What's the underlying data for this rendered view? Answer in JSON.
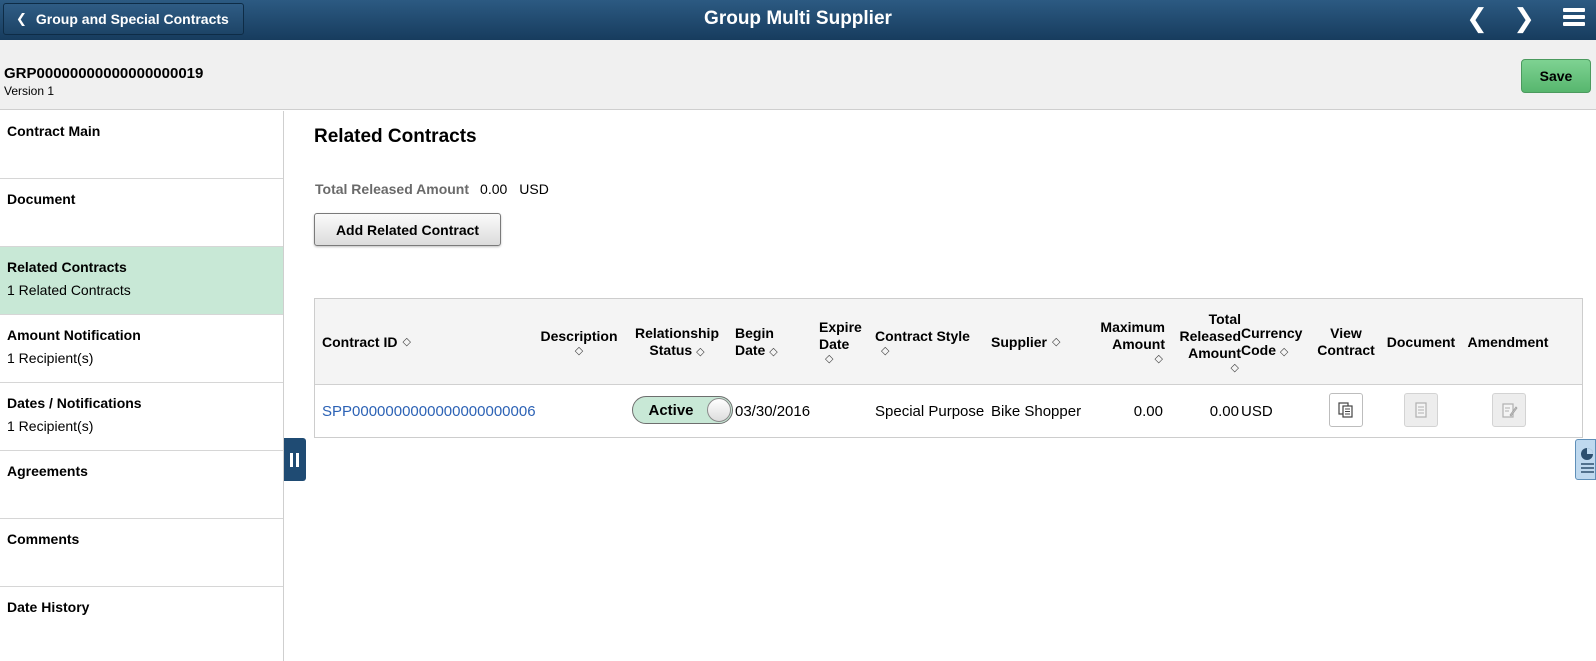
{
  "banner": {
    "back_label": "Group and Special Contracts",
    "title": "Group Multi Supplier"
  },
  "header": {
    "group_id": "GRP00000000000000000019",
    "version": "Version 1",
    "save_label": "Save"
  },
  "sidebar": {
    "items": [
      {
        "label": "Contract Main",
        "sub": ""
      },
      {
        "label": "Document",
        "sub": ""
      },
      {
        "label": "Related Contracts",
        "sub": "1 Related Contracts",
        "selected": true
      },
      {
        "label": "Amount Notification",
        "sub": "1 Recipient(s)"
      },
      {
        "label": "Dates / Notifications",
        "sub": "1 Recipient(s)"
      },
      {
        "label": "Agreements",
        "sub": ""
      },
      {
        "label": "Comments",
        "sub": ""
      },
      {
        "label": "Date History",
        "sub": ""
      }
    ]
  },
  "main": {
    "title": "Related Contracts",
    "total_label": "Total Released Amount",
    "total_value": "0.00",
    "total_currency": "USD",
    "add_label": "Add Related Contract"
  },
  "grid": {
    "columns": {
      "contract_id": "Contract ID",
      "description": "Description",
      "relationship_status": [
        "Relationship",
        "Status"
      ],
      "begin_date": [
        "Begin",
        "Date"
      ],
      "expire_date": [
        "Expire",
        "Date"
      ],
      "contract_style": "Contract Style",
      "supplier": "Supplier",
      "maximum_amount": [
        "Maximum",
        "Amount"
      ],
      "total_released_amount": [
        "Total",
        "Released",
        "Amount"
      ],
      "currency_code": [
        "Currency",
        "Code"
      ],
      "view_contract": [
        "View",
        "Contract"
      ],
      "document": "Document",
      "amendment": "Amendment"
    },
    "rows": [
      {
        "contract_id": "SPP0000000000000000000006",
        "description": "",
        "status": "Active",
        "begin_date": "03/30/2016",
        "expire_date": "",
        "contract_style": "Special Purpose",
        "supplier": "Bike Shopper",
        "maximum_amount": "0.00",
        "total_released_amount": "0.00",
        "currency_code": "USD"
      }
    ]
  },
  "colors": {
    "banner": "#1f4b73",
    "selected_nav": "#c8e8d6",
    "save_button": "#6cc684",
    "link": "#2c62b5"
  }
}
